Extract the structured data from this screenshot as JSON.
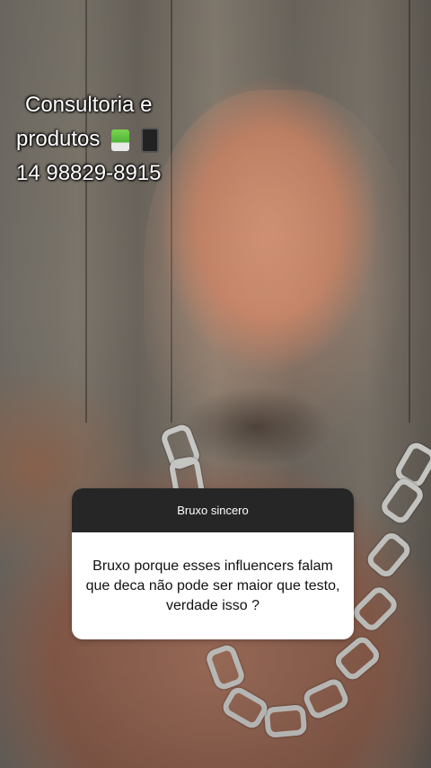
{
  "overlay": {
    "line1": "Consultoria e",
    "line2": "produtos",
    "phone": "14 98829-8915",
    "icons": [
      "juice-box-icon",
      "mobile-phone-icon"
    ]
  },
  "question_box": {
    "title": "Bruxo sincero",
    "question": "Bruxo porque esses influencers falam que deca não pode ser maior que testo, verdade isso ?",
    "colors": {
      "header_bg": "#262626",
      "body_bg": "#ffffff"
    }
  }
}
